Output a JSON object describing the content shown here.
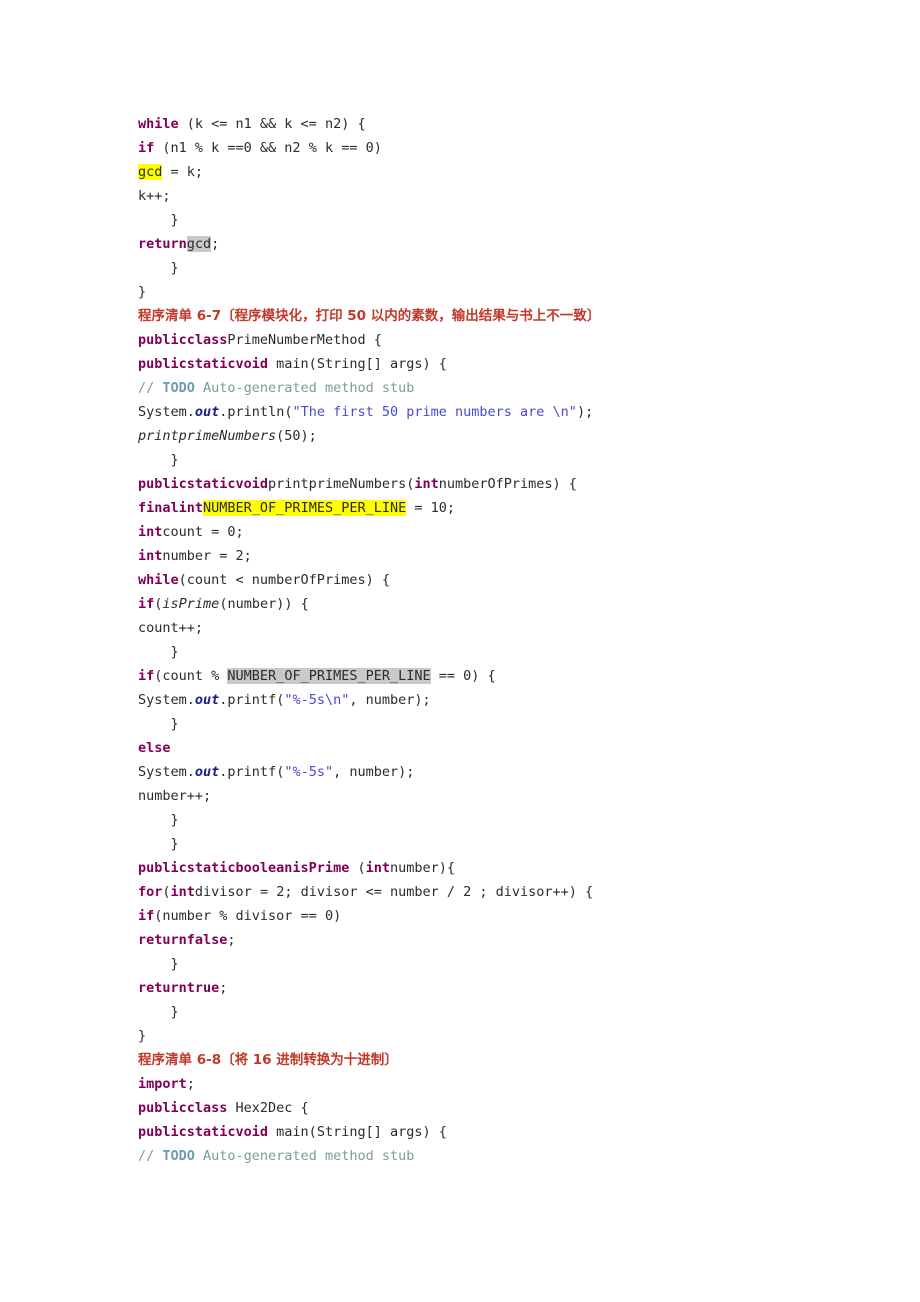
{
  "document": {
    "type": "code-listing-page",
    "language": "Java",
    "page_background": "#ffffff",
    "colors": {
      "keyword": "#7f0055",
      "string": "#4a4ad0",
      "comment": "#7f9b9b",
      "todo": "#6f9ab0",
      "field": "#1a1a8c",
      "heading_red": "#c0392b",
      "highlight_yellow": "#ffff00",
      "highlight_gray": "#c9c9c9",
      "text": "#2b2b2b"
    }
  },
  "headings": {
    "listing_6_7": "程序清单 6-7〔程序模块化，打印 50 以内的素数，输出结果与书上不一致〕",
    "listing_6_8": "程序清单 6-8〔将 16 进制转换为十进制〕"
  },
  "code": {
    "block_gcd": {
      "l1_kw": "while",
      "l1_rest": " (k <= n1 && k <= n2) {",
      "l2_kw": "if",
      "l2_rest": " (n1 % k ==0 && n2 % k == 0)",
      "l3_hl": "gcd",
      "l3_rest": " = k;",
      "l4": "k++;",
      "l5": "    }",
      "l6_kw": "return",
      "l6_hl": "gcd",
      "l6_rest": ";",
      "l7": "    }",
      "l8": "}"
    },
    "block_prime": {
      "c1_kw": "publicclass",
      "c1_rest": "PrimeNumberMethod {",
      "c2_kw": "publicstaticvoid",
      "c2_rest": " main(String[] args) {",
      "c3_slashes": "// ",
      "c3_todo": "TODO",
      "c3_cmt": " Auto-generated method stub",
      "c4_a": "System.",
      "c4_fld": "out",
      "c4_b": ".println(",
      "c4_str": "\"The first 50 prime numbers are \\n\"",
      "c4_c": ");",
      "c5_mth": "printprimeNumbers",
      "c5_rest": "(50);",
      "c6": "    }",
      "c7_kw": "publicstaticvoid",
      "c7_mid": "printprimeNumbers(",
      "c7_kw2": "int",
      "c7_rest": "numberOfPrimes) {",
      "c8_kw": "finalint",
      "c8_hl": "NUMBER_OF_PRIMES_PER_LINE",
      "c8_rest": " = 10;",
      "c9_kw": "int",
      "c9_rest": "count = 0;",
      "c10_kw": "int",
      "c10_rest": "number = 2;",
      "c11_kw": "while",
      "c11_rest": "(count < numberOfPrimes) {",
      "c12_kw": "if",
      "c12_a": "(",
      "c12_mth": "isPrime",
      "c12_rest": "(number)) {",
      "c13": "count++;",
      "c14": "    }",
      "c15_kw": "if",
      "c15_a": "(count % ",
      "c15_hl": "NUMBER_OF_PRIMES_PER_LINE",
      "c15_rest": " == 0) {",
      "c16_a": "System.",
      "c16_fld": "out",
      "c16_b": ".printf(",
      "c16_str": "\"%-5s\\n\"",
      "c16_c": ", number);",
      "c17": "    }",
      "c18_kw": "else",
      "c19_a": "System.",
      "c19_fld": "out",
      "c19_b": ".printf(",
      "c19_str": "\"%-5s\"",
      "c19_c": ", number);",
      "c20": "number++;",
      "c21": "    }",
      "c22": "    }",
      "c23_kw": "publicstaticbooleanisPrime",
      "c23_a": " (",
      "c23_kw2": "int",
      "c23_rest": "number){",
      "c24_kw": "for",
      "c24_a": "(",
      "c24_kw2": "int",
      "c24_rest": "divisor = 2; divisor <= number / 2 ; divisor++) {",
      "c25_kw": "if",
      "c25_rest": "(number % divisor == 0)",
      "c26_kw": "returnfalse",
      "c26_rest": ";",
      "c27": "    }",
      "c28_kw": "returntrue",
      "c28_rest": ";",
      "c29": "    }",
      "c30": "}"
    },
    "block_hex": {
      "h1_kw": "import",
      "h1_rest": ";",
      "h2_kw": "publicclass",
      "h2_rest": " Hex2Dec {",
      "h3_kw": "publicstaticvoid",
      "h3_rest": " main(String[] args) {",
      "h4_slashes": "// ",
      "h4_todo": "TODO",
      "h4_cmt": " Auto-generated method stub"
    }
  }
}
